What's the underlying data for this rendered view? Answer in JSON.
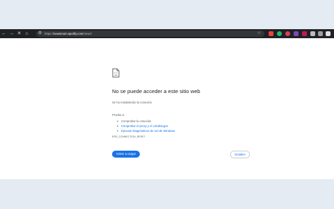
{
  "browser": {
    "url_scheme": "https://",
    "url_host": "newsroom.spotify.com",
    "url_path": "/news/",
    "nav_icons": [
      "back-icon",
      "forward-icon",
      "stop-icon",
      "home-icon"
    ],
    "extension_colors": [
      "#e8453c",
      "#2ab673",
      "#d93f59",
      "#7b4ab7",
      "#c2185b",
      "#bdbdbd",
      "#9e9e9e",
      "#e0e0e0"
    ]
  },
  "error_page": {
    "title": "No se puede acceder a este sitio web",
    "subtitle": "Se ha restablecido la conexión.",
    "try_label": "Prueba a:",
    "suggestions": [
      "Comprobar la conexión",
      "Comprobar el proxy y el cortafuegos",
      "Ejecutar Diagnósticos de red de Windows"
    ],
    "error_code": "ERR_CONNECTION_RESET",
    "reload_label": "Volver a cargar",
    "details_label": "Detalles"
  }
}
